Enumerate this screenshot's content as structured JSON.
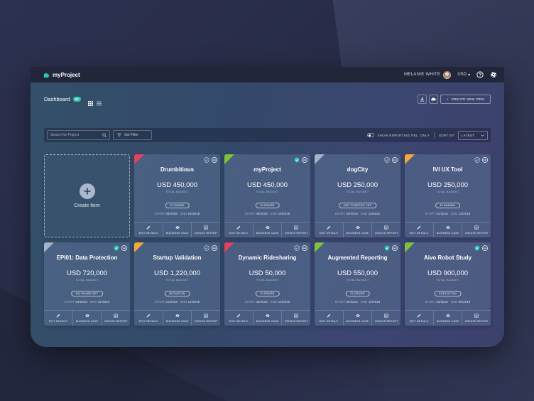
{
  "header": {
    "app_name": "myProject",
    "user_name": "MELANIE WHITE",
    "currency": "USD"
  },
  "toolbar": {
    "breadcrumb": "Dashboard",
    "item_count": "47",
    "create_new_label": "CREATE NEW ITEM",
    "search_placeholder": "Search for Project",
    "filter_label": "Set Filter",
    "reporting_toggle_label": "SHOW REPORTING REL. ONLY",
    "sort_label": "SORT BY:",
    "sort_value": "LATEST"
  },
  "create_card": {
    "label": "Create Item"
  },
  "card_common": {
    "budget_label": "TOTAL BUDGET",
    "start_label": "START",
    "end_label": "END",
    "action_edit": "EDIT DETAILS",
    "action_case": "BUSINESS CASE",
    "action_report": "CREATE REPORT"
  },
  "colors": {
    "red": "#e5425c",
    "green": "#7dc43a",
    "grey": "#a7b3c6",
    "orange": "#f4a93b",
    "teal": "#2fc6b5"
  },
  "cards": [
    {
      "title": "Drumbitious",
      "budget": "USD 450,000",
      "phase": "CLOSURE",
      "start": "08/2008",
      "end": "03/2018",
      "status_color": "#e5425c",
      "shield_active": false
    },
    {
      "title": "myProject",
      "budget": "USD 450,000",
      "phase": "CLOSURE",
      "start": "06/2016",
      "end": "10/2018",
      "status_color": "#7dc43a",
      "shield_active": true
    },
    {
      "title": "dogCity",
      "budget": "USD 250,000",
      "phase": "NOT STARTED YET",
      "start": "03/2018",
      "end": "12/2022",
      "status_color": "#a7b3c6",
      "shield_active": false
    },
    {
      "title": "IVI UX Tool",
      "budget": "USD 250,000",
      "phase": "PLANNING",
      "start": "01/2018",
      "end": "12/2018",
      "status_color": "#f4a93b",
      "shield_active": false
    },
    {
      "title": "EPI01: Data Protection",
      "budget": "USD 720,000",
      "phase": "NO PHASE SET",
      "start": "03/2018",
      "end": "12/2022",
      "status_color": "#a7b3c6",
      "shield_active": true
    },
    {
      "title": "Startup Validation",
      "budget": "USD 1,220,000",
      "phase": "INITIATION",
      "start": "01/2018",
      "end": "12/2018",
      "status_color": "#f4a93b",
      "shield_active": false
    },
    {
      "title": "Dynamic Ridesharing",
      "budget": "USD 50,000",
      "phase": "CLOSURE",
      "start": "03/2018",
      "end": "10/2018",
      "status_color": "#e5425c",
      "shield_active": false
    },
    {
      "title": "Augmented Reporting",
      "budget": "USD 550,000",
      "phase": "CLOSURE",
      "start": "06/2016",
      "end": "10/2018",
      "status_color": "#7dc43a",
      "shield_active": true
    },
    {
      "title": "Aivo Robot Study",
      "budget": "USD 900,000",
      "phase": "EXECUTION",
      "start": "03/2018",
      "end": "05/2019",
      "status_color": "#7dc43a",
      "shield_active": true
    }
  ]
}
